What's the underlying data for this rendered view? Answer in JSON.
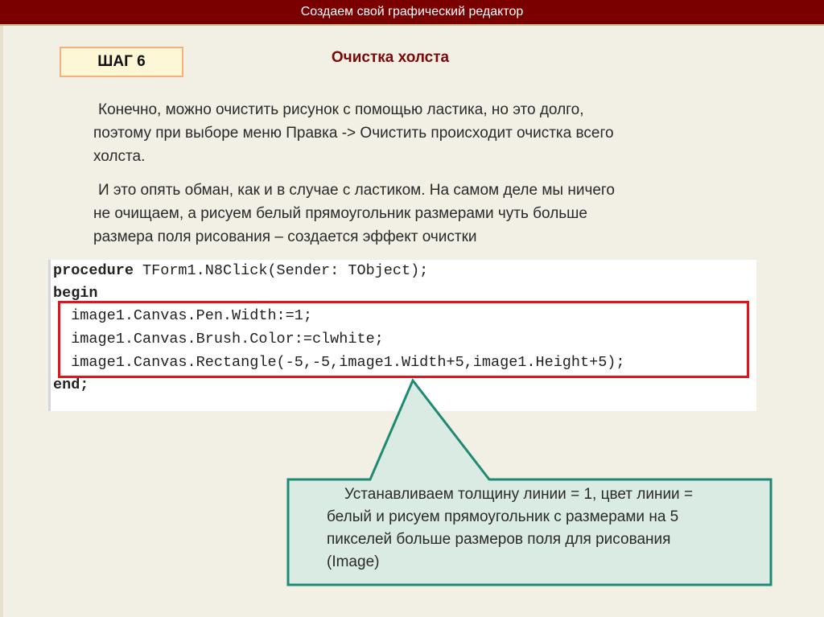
{
  "header": {
    "title": "Создаем свой графический редактор"
  },
  "step": {
    "label": "ШАГ 6"
  },
  "slide": {
    "title": "Очистка холста"
  },
  "paragraphs": [
    {
      "lines": [
        "Конечно, можно очистить рисунок с помощью ластика, но это долго,",
        "поэтому при выборе меню Правка -> Очистить происходит очистка всего",
        "холста."
      ]
    },
    {
      "lines": [
        "И это опять обман, как и в случае с ластиком. На самом деле мы ничего",
        "не очищаем, а рисуем белый прямоугольник размерами чуть больше",
        "размера поля рисования – создается эффект очистки"
      ]
    }
  ],
  "code": {
    "lines": [
      {
        "kw": "procedure",
        "text": " TForm1.N8Click(Sender: TObject);"
      },
      {
        "kw": "begin",
        "text": ""
      },
      {
        "kw": "",
        "text": "  image1.Canvas.Pen.Width:=1;"
      },
      {
        "kw": "",
        "text": "  image1.Canvas.Brush.Color:=clwhite;"
      },
      {
        "kw": "",
        "text": "  image1.Canvas.Rectangle(-5,-5,image1.Width+5,image1.Height+5);"
      },
      {
        "kw": "end;",
        "text": ""
      }
    ]
  },
  "callout": {
    "lines": [
      "Устанавливаем толщину линии = 1, цвет линии =",
      "белый и рисуем прямоугольник с размерами на 5",
      "пикселей больше размеров поля для рисования",
      "(Image)"
    ]
  },
  "colors": {
    "header_bg": "#7a0000",
    "title_color": "#7a0a0a",
    "highlight_border": "#e0141a",
    "callout_fill": "#d9ebe3",
    "callout_border": "#1e8a73"
  }
}
